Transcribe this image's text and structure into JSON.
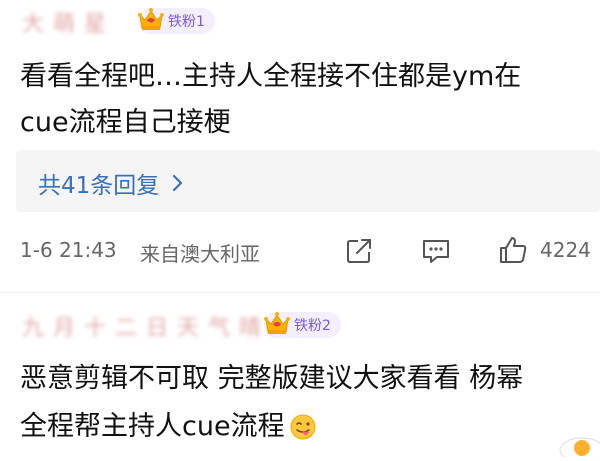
{
  "comment1": {
    "username": "大 萌 星",
    "badge": "铁粉1",
    "text_line1": "看看全程吧…主持人全程接不住都是ym在",
    "text_line2": "cue流程自己接梗",
    "replies": "共41条回复",
    "time": "1-6 21:43",
    "location": "来自澳大利亚",
    "likes": "4224"
  },
  "comment2": {
    "username": "九 月 十 二 日 天 气 晴 朗",
    "badge": "铁粉2",
    "text_line1": "恶意剪辑不可取 完整版建议大家看看 杨幂",
    "text_line2": "全程帮主持人cue流程"
  },
  "icons": {
    "share": "share-icon",
    "comment": "comment-icon",
    "like": "thumbs-up-icon",
    "emoji": "tongue-face-emoji"
  },
  "colors": {
    "reply_link": "#3b6fb6",
    "badge_bg": "#f4efff",
    "badge_text": "#7d5bd8"
  }
}
